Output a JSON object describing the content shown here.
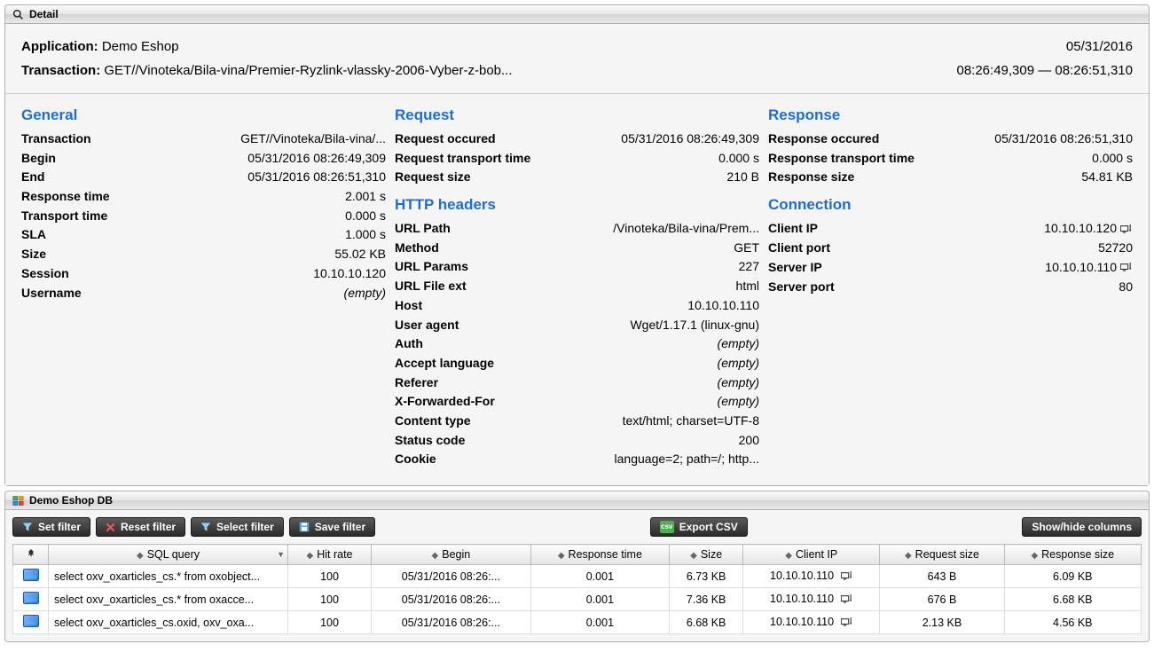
{
  "detail": {
    "title": "Detail",
    "application_label": "Application:",
    "application_value": "Demo Eshop",
    "transaction_label": "Transaction:",
    "transaction_value": "GET//Vinoteka/Bila-vina/Premier-Ryzlink-vlassky-2006-Vyber-z-bob...",
    "date": "05/31/2016",
    "time_range": "08:26:49,309 — 08:26:51,310"
  },
  "general": {
    "title": "General",
    "rows": [
      {
        "k": "Transaction",
        "v": "GET//Vinoteka/Bila-vina/..."
      },
      {
        "k": "Begin",
        "v": "05/31/2016 08:26:49,309"
      },
      {
        "k": "End",
        "v": "05/31/2016 08:26:51,310"
      },
      {
        "k": "Response time",
        "v": "2.001 s"
      },
      {
        "k": "Transport time",
        "v": "0.000 s"
      },
      {
        "k": "SLA",
        "v": "1.000 s"
      },
      {
        "k": "Size",
        "v": "55.02 KB"
      },
      {
        "k": "Session",
        "v": "10.10.10.120"
      },
      {
        "k": "Username",
        "v": "(empty)",
        "empty": true
      }
    ]
  },
  "request": {
    "title": "Request",
    "rows": [
      {
        "k": "Request occured",
        "v": "05/31/2016 08:26:49,309"
      },
      {
        "k": "Request transport time",
        "v": "0.000 s"
      },
      {
        "k": "Request size",
        "v": "210 B"
      }
    ]
  },
  "http": {
    "title": "HTTP headers",
    "rows": [
      {
        "k": "URL Path",
        "v": "/Vinoteka/Bila-vina/Prem..."
      },
      {
        "k": "Method",
        "v": "GET"
      },
      {
        "k": "URL Params",
        "v": "227"
      },
      {
        "k": "URL File ext",
        "v": "html"
      },
      {
        "k": "Host",
        "v": "10.10.10.110"
      },
      {
        "k": "User agent",
        "v": "Wget/1.17.1 (linux-gnu)"
      },
      {
        "k": "Auth",
        "v": "(empty)",
        "empty": true
      },
      {
        "k": "Accept language",
        "v": "(empty)",
        "empty": true
      },
      {
        "k": "Referer",
        "v": "(empty)",
        "empty": true
      },
      {
        "k": "X-Forwarded-For",
        "v": "(empty)",
        "empty": true
      },
      {
        "k": "Content type",
        "v": "text/html; charset=UTF-8"
      },
      {
        "k": "Status code",
        "v": "200"
      },
      {
        "k": "Cookie",
        "v": "language=2; path=/; http..."
      }
    ]
  },
  "response": {
    "title": "Response",
    "rows": [
      {
        "k": "Response occured",
        "v": "05/31/2016 08:26:51,310"
      },
      {
        "k": "Response transport time",
        "v": "0.000 s"
      },
      {
        "k": "Response size",
        "v": "54.81 KB"
      }
    ]
  },
  "connection": {
    "title": "Connection",
    "rows": [
      {
        "k": "Client IP",
        "v": "10.10.10.120",
        "net": true
      },
      {
        "k": "Client port",
        "v": "52720"
      },
      {
        "k": "Server IP",
        "v": "10.10.10.110",
        "net": true
      },
      {
        "k": "Server port",
        "v": "80"
      }
    ]
  },
  "db": {
    "title": "Demo Eshop DB",
    "buttons": {
      "set_filter": "Set filter",
      "reset_filter": "Reset filter",
      "select_filter": "Select filter",
      "save_filter": "Save filter",
      "export_csv": "Export CSV",
      "show_hide": "Show/hide columns"
    },
    "columns": [
      "",
      "SQL query",
      "Hit rate",
      "Begin",
      "Response time",
      "Size",
      "Client IP",
      "Request size",
      "Response size"
    ],
    "rows": [
      {
        "sql": "select oxv_oxarticles_cs.* from oxobject...",
        "hit": "100",
        "begin": "05/31/2016 08:26:...",
        "rt": "0.001",
        "size": "6.73 KB",
        "ip": "10.10.10.110",
        "req": "643 B",
        "resp": "6.09 KB"
      },
      {
        "sql": "select oxv_oxarticles_cs.* from oxacce...",
        "hit": "100",
        "begin": "05/31/2016 08:26:...",
        "rt": "0.001",
        "size": "7.36 KB",
        "ip": "10.10.10.110",
        "req": "676 B",
        "resp": "6.68 KB"
      },
      {
        "sql": "select oxv_oxarticles_cs.oxid, oxv_oxa...",
        "hit": "100",
        "begin": "05/31/2016 08:26:...",
        "rt": "0.001",
        "size": "6.68 KB",
        "ip": "10.10.10.110",
        "req": "2.13 KB",
        "resp": "4.56 KB"
      }
    ]
  }
}
